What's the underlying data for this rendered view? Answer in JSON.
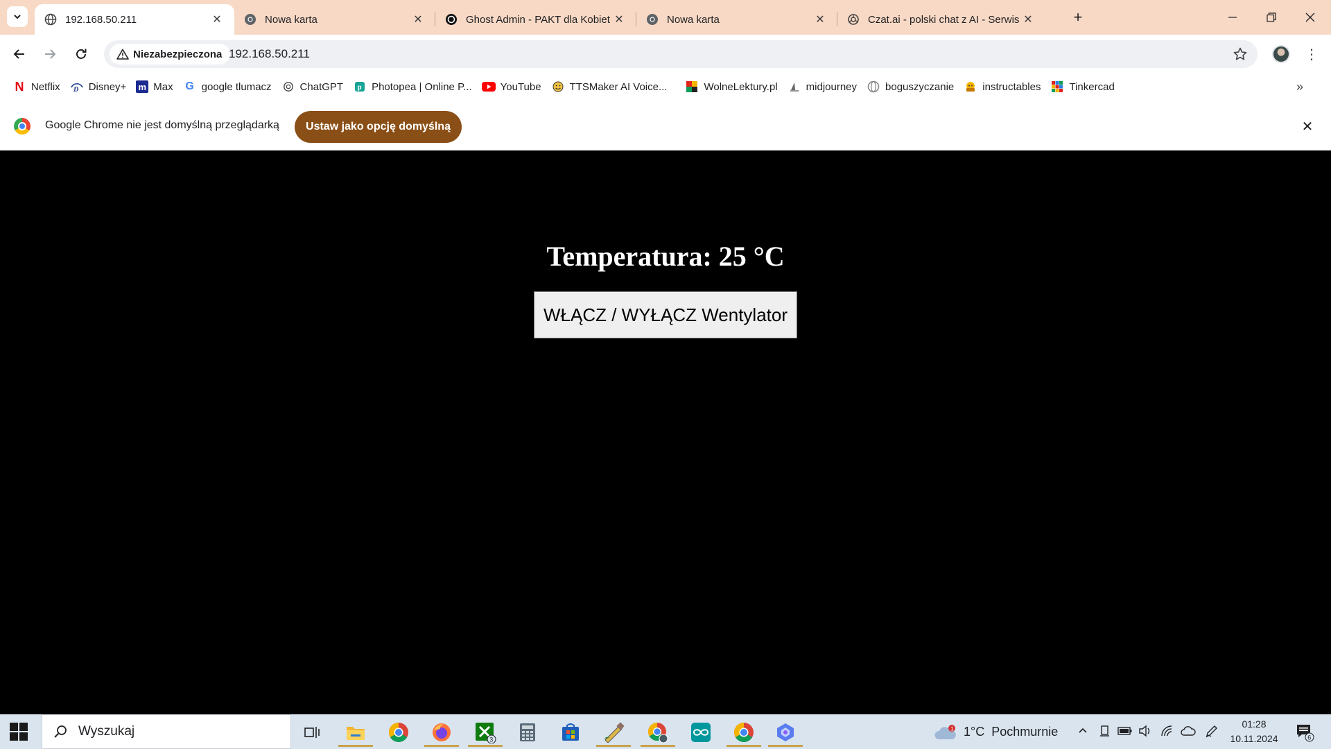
{
  "browser": {
    "tabs": [
      {
        "title": "192.168.50.211",
        "active": true,
        "icon": "globe-icon"
      },
      {
        "title": "Nowa karta",
        "active": false,
        "icon": "chrome-icon"
      },
      {
        "title": "Ghost Admin - PAKT dla Kobiet",
        "active": false,
        "icon": "ghost-icon"
      },
      {
        "title": "Nowa karta",
        "active": false,
        "icon": "chrome-icon"
      },
      {
        "title": "Czat.ai - polski chat z AI - Serwis",
        "active": false,
        "icon": "openai-icon"
      }
    ],
    "security_label": "Niezabezpieczona",
    "url": "192.168.50.211"
  },
  "bookmarks": [
    {
      "label": "Netflix",
      "icon": "netflix-icon"
    },
    {
      "label": "Disney+",
      "icon": "disney-icon"
    },
    {
      "label": "Max",
      "icon": "max-icon"
    },
    {
      "label": "google tlumacz",
      "icon": "google-icon"
    },
    {
      "label": "ChatGPT",
      "icon": "openai-icon"
    },
    {
      "label": "Photopea | Online P...",
      "icon": "photopea-icon"
    },
    {
      "label": "YouTube",
      "icon": "youtube-icon"
    },
    {
      "label": "TTSMaker AI Voice...",
      "icon": "ttsmaker-icon"
    },
    {
      "label": "WolneLektury.pl",
      "icon": "wolnelektury-icon"
    },
    {
      "label": "midjourney",
      "icon": "midjourney-icon"
    },
    {
      "label": "boguszyczanie",
      "icon": "globe-icon"
    },
    {
      "label": "instructables",
      "icon": "instructables-icon"
    },
    {
      "label": "Tinkercad",
      "icon": "tinkercad-icon"
    }
  ],
  "infobar": {
    "message": "Google Chrome nie jest domyślną przeglądarką",
    "button_label": "Ustaw jako opcję domyślną"
  },
  "page": {
    "temperature_text": "Temperatura: 25 °C",
    "fan_button_label": "WŁĄCZ / WYŁĄCZ Wentylator"
  },
  "taskbar": {
    "search_placeholder": "Wyszukaj",
    "xbox_badge": "3",
    "weather_badge": "1",
    "weather": "1°C  Pochmurnie",
    "time": "01:28",
    "date": "10.11.2024",
    "notification_count": "6"
  },
  "colors": {
    "tabstrip": "#f8d9c5",
    "infobar_button": "#8a4f16",
    "page_background": "#000000",
    "taskbar": "#d9e4ee"
  }
}
